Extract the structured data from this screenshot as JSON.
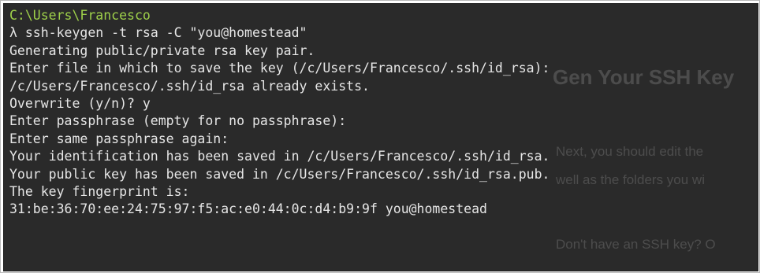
{
  "background_text": {
    "heading": "Gen   Your SSH Key",
    "para1": "Next, you should edit the",
    "para2": "well as the folders you wi",
    "para3": "Don't have an SSH key? O"
  },
  "terminal": {
    "cwd": "C:\\Users\\Francesco",
    "prompt_symbol": "λ",
    "command": " ssh-keygen -t rsa -C \"you@homestead\"",
    "output": [
      "Generating public/private rsa key pair.",
      "Enter file in which to save the key (/c/Users/Francesco/.ssh/id_rsa):",
      "/c/Users/Francesco/.ssh/id_rsa already exists.",
      "Overwrite (y/n)? y",
      "Enter passphrase (empty for no passphrase):",
      "Enter same passphrase again:",
      "Your identification has been saved in /c/Users/Francesco/.ssh/id_rsa.",
      "Your public key has been saved in /c/Users/Francesco/.ssh/id_rsa.pub.",
      "The key fingerprint is:",
      "31:be:36:70:ee:24:75:97:f5:ac:e0:44:0c:d4:b9:9f you@homestead"
    ],
    "colors": {
      "background": "#2a2a2a",
      "text": "#e6e6e6",
      "path": "#9ed04a"
    }
  }
}
